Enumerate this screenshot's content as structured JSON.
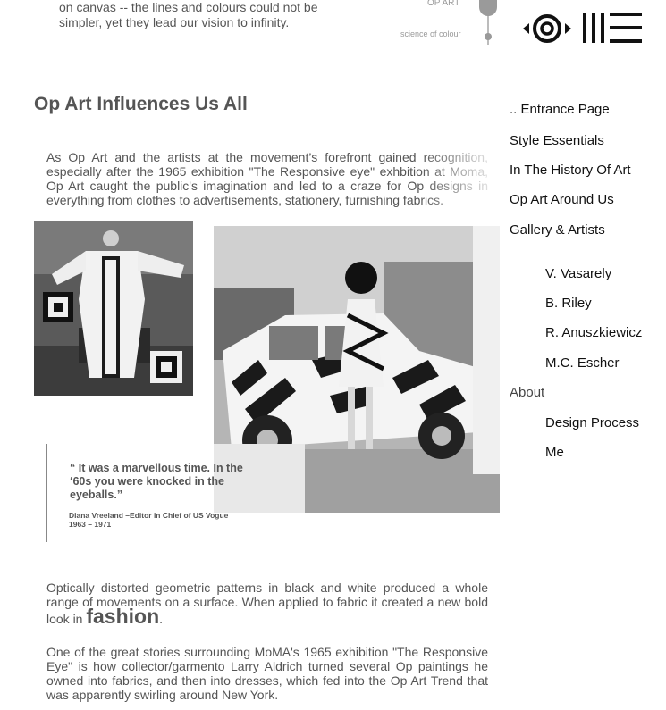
{
  "intro": {
    "line1": "on canvas -- the lines and colours could not be",
    "line2": "simpler, yet they lead our vision to infinity."
  },
  "logo": {
    "label_top": "OP ART",
    "label_bottom": "science of colour"
  },
  "icons": {
    "eye": "eye-icon",
    "bars": "menu-bars-icon"
  },
  "page_title": "Op Art Influences Us All",
  "para1": "As Op Art and the artists at the movement’s forefront gained recognition, especially after the 1965 exhibition \"The Responsive eye\" exhbition at Moma, Op Art caught the public's imagination and led to a craze for Op designs in everything from clothes to advertisements, stationery, furnishing fabrics.",
  "quote": {
    "text": "“ It was a marvellous time. In the ‘60s you were knocked in the eyeballs.”",
    "attribution": "Diana Vreeland   –Editor in Chief of US Vogue 1963 – 1971"
  },
  "para2": {
    "before": "Optically distorted geometric patterns in black and white produced a whole range of movements on a surface. When applied to fabric it created a new bold look in ",
    "highlight": "fashion",
    "after": "."
  },
  "para3": "One of the great stories surrounding MoMA's 1965 exhibition \"The Responsive Eye\" is how collector/garmento Larry Aldrich turned several Op paintings he owned into fabrics, and then into dresses, which fed into the Op Art Trend that was apparently swirling around New York.",
  "nav": {
    "entrance": ".. Entrance Page",
    "style": "Style Essentials",
    "history": "In The History Of Art",
    "around": "Op Art Around Us",
    "gallery": "Gallery & Artists",
    "vasarely": "V. Vasarely",
    "riley": "B. Riley",
    "anuszkiewicz": "R. Anuszkiewicz",
    "escher": "M.C. Escher",
    "about": "About",
    "design": "Design Process",
    "me": "Me"
  },
  "colors": {
    "text": "#555555",
    "nav_text": "#111111",
    "accent_gray": "#9a9a9a"
  }
}
